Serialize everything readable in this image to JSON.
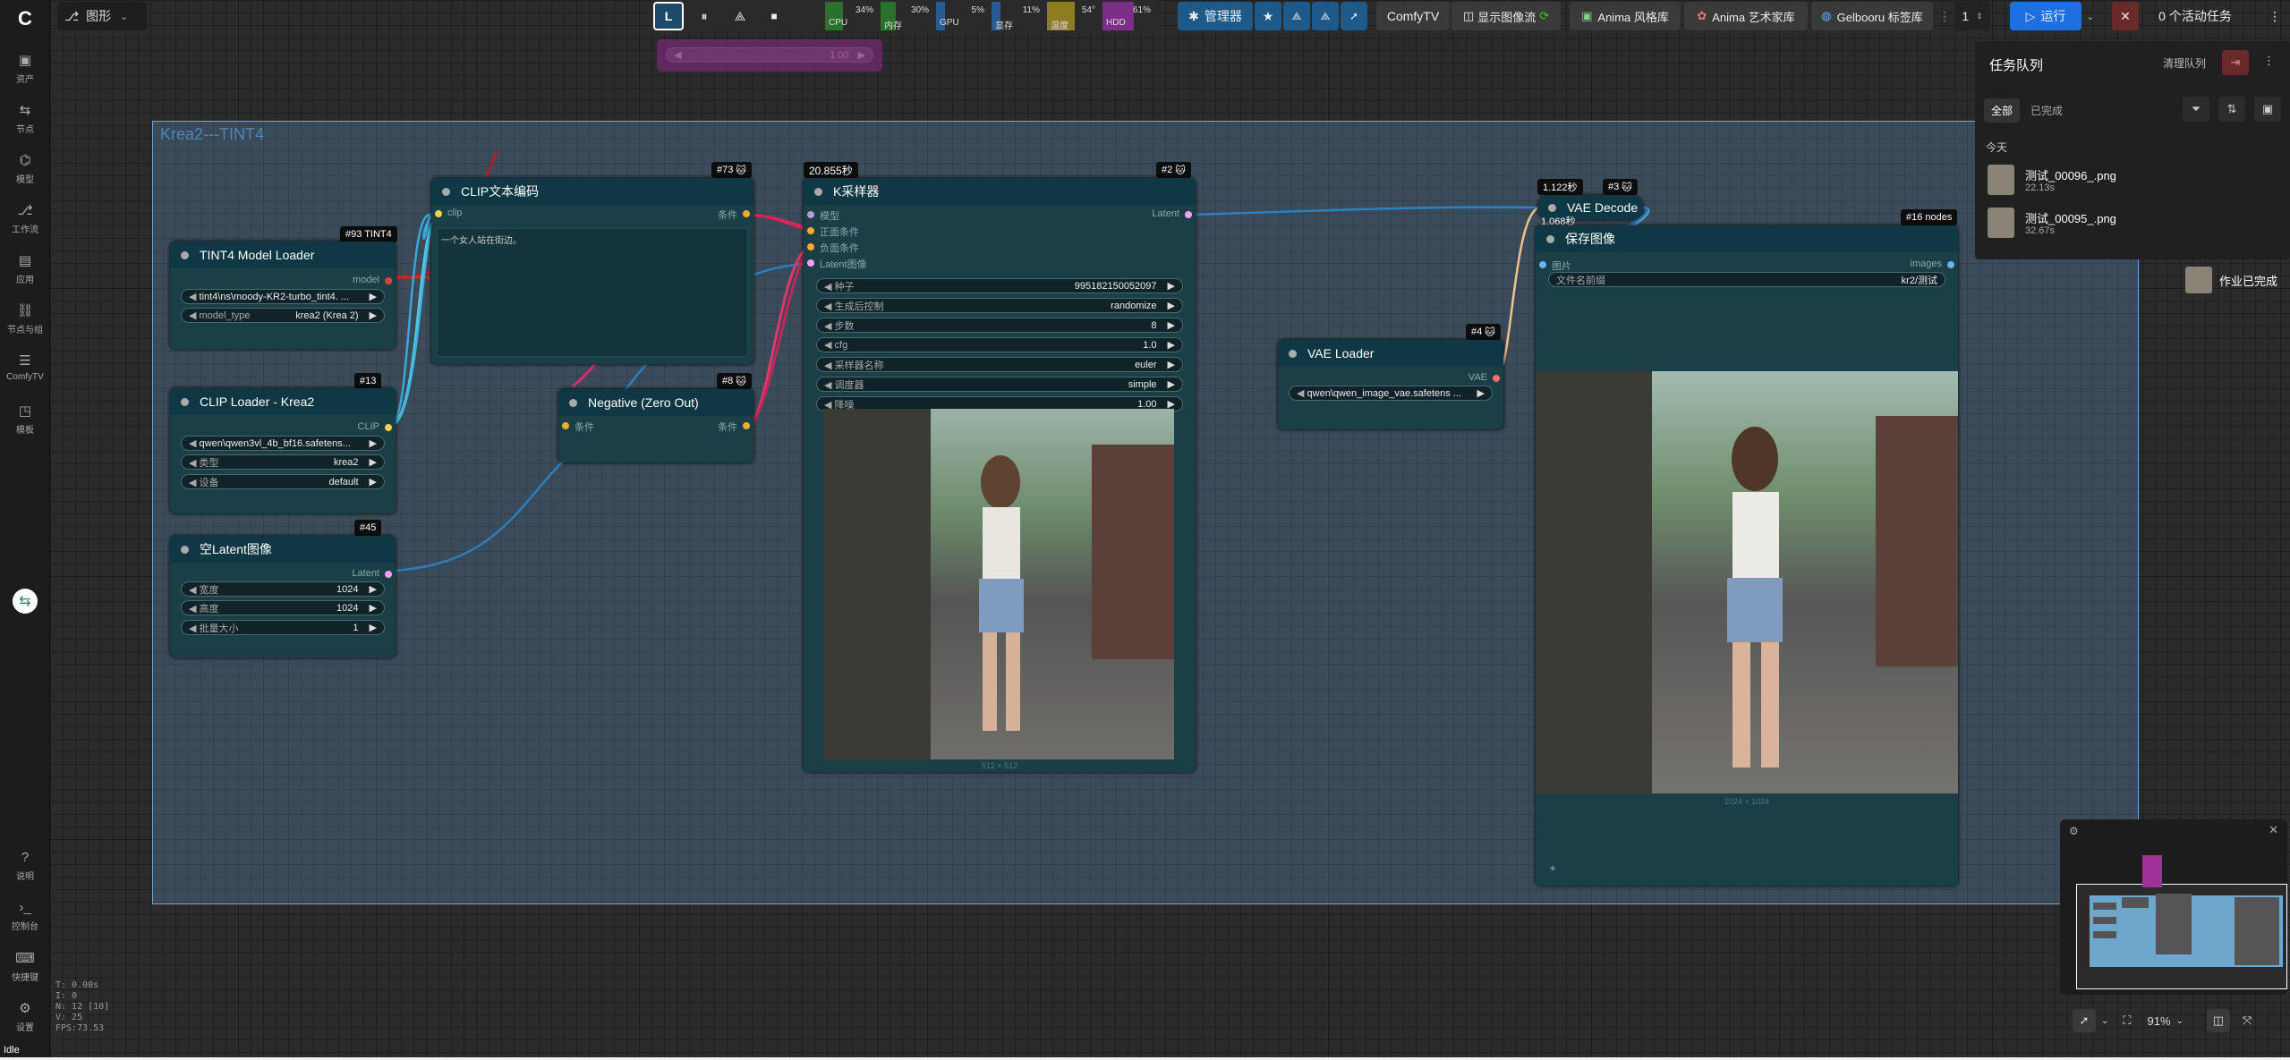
{
  "app": {
    "workflow_menu": "图形",
    "status": "Idle"
  },
  "sidebar": {
    "items": [
      {
        "label": "资产",
        "icon": "image-icon"
      },
      {
        "label": "节点",
        "icon": "node-icon"
      },
      {
        "label": "模型",
        "icon": "model-icon"
      },
      {
        "label": "工作流",
        "icon": "workflow-icon"
      },
      {
        "label": "应用",
        "icon": "app-icon"
      },
      {
        "label": "节点与组",
        "icon": "nodes-groups-icon"
      },
      {
        "label": "ComfyTV",
        "icon": "sliders-icon"
      },
      {
        "label": "模板",
        "icon": "template-icon"
      }
    ],
    "bottom": [
      {
        "label": "说明",
        "icon": "help-icon"
      },
      {
        "label": "控制台",
        "icon": "terminal-icon"
      },
      {
        "label": "快捷键",
        "icon": "keyboard-icon"
      },
      {
        "label": "设置",
        "icon": "gear-icon"
      }
    ]
  },
  "monitor": {
    "cpu": {
      "label": "CPU",
      "value": "34%"
    },
    "mem": {
      "label": "内存",
      "value": "30%"
    },
    "gpu": {
      "label": "GPU",
      "value": "5%"
    },
    "vram": {
      "label": "显存",
      "value": "11%"
    },
    "temp": {
      "label": "温度",
      "value": "54°"
    },
    "hdd": {
      "label": "HDD",
      "value": "61%"
    }
  },
  "toolbar": {
    "manager": "管理器",
    "comfytv": "ComfyTV",
    "show_image_flow": "显示图像流",
    "anima_style": "Anima 风格库",
    "anima_art": "Anima 艺术家库",
    "gelbooru": "Gelbooru 标签库",
    "batch": "1",
    "run": "运行",
    "active_tasks": "0 个活动任务"
  },
  "ghost_node": {
    "value": "1.00"
  },
  "group": {
    "title": "Krea2---TINT4"
  },
  "nodes": {
    "tint4": {
      "badge": "#93 TINT4",
      "title": "TINT4 Model Loader",
      "out": "model",
      "w1": "tint4\\ns\\moody-KR2-turbo_tint4. ...",
      "w2_label": "model_type",
      "w2_val": "krea2 (Krea 2)"
    },
    "clip_loader": {
      "badge": "#13",
      "title": "CLIP Loader - Krea2",
      "out": "CLIP",
      "w1": "qwen\\qwen3vl_4b_bf16.safetens...",
      "w2_label": "类型",
      "w2_val": "krea2",
      "w3_label": "设备",
      "w3_val": "default"
    },
    "latent": {
      "badge": "#45",
      "title": "空Latent图像",
      "out": "Latent",
      "w1_label": "宽度",
      "w1_val": "1024",
      "w2_label": "高度",
      "w2_val": "1024",
      "w3_label": "批量大小",
      "w3_val": "1"
    },
    "clip_text": {
      "badge": "#73",
      "title": "CLIP文本编码",
      "in": "clip",
      "out": "条件",
      "text": "一个女人站在街边。"
    },
    "negative": {
      "badge": "#8",
      "title": "Negative (Zero Out)",
      "in": "条件",
      "out": "条件"
    },
    "ksampler": {
      "badge": "#2",
      "time": "20.855秒",
      "title": "K采样器",
      "in1": "模型",
      "in2": "正面条件",
      "in3": "负面条件",
      "in4": "Latent图像",
      "out": "Latent",
      "widgets": [
        {
          "l": "种子",
          "v": "995182150052097"
        },
        {
          "l": "生成后控制",
          "v": "randomize"
        },
        {
          "l": "步数",
          "v": "8"
        },
        {
          "l": "cfg",
          "v": "1.0"
        },
        {
          "l": "采样器名称",
          "v": "euler"
        },
        {
          "l": "调度器",
          "v": "simple"
        },
        {
          "l": "降噪",
          "v": "1.00"
        }
      ],
      "preview_size": "512 × 512"
    },
    "vae_loader": {
      "badge": "#4",
      "title": "VAE Loader",
      "out": "VAE",
      "w1": "qwen\\qwen_image_vae.safetens ..."
    },
    "vae_decode": {
      "badge": "#3",
      "time1": "1.122秒",
      "time2": "1.068秒",
      "title": "VAE Decode"
    },
    "save_image": {
      "badge": "#16 nodes",
      "title": "保存图像",
      "in": "图片",
      "out": "images",
      "w1_label": "文件名前缀",
      "w1_val": "kr2/测试",
      "preview_size": "1024 × 1024"
    }
  },
  "queue": {
    "title": "任务队列",
    "clear": "清理队列",
    "tab_all": "全部",
    "tab_done": "已完成",
    "section": "今天",
    "items": [
      {
        "name": "测试_00096_.png",
        "time": "22.13s"
      },
      {
        "name": "测试_00095_.png",
        "time": "32.67s"
      }
    ],
    "job_done": "作业已完成"
  },
  "stats": {
    "t": "T: 0.00s",
    "i": "I: 0",
    "n": "N: 12 [10]",
    "v": "V: 25",
    "fps": "FPS:73.53"
  },
  "zoom": {
    "value": "91%"
  }
}
